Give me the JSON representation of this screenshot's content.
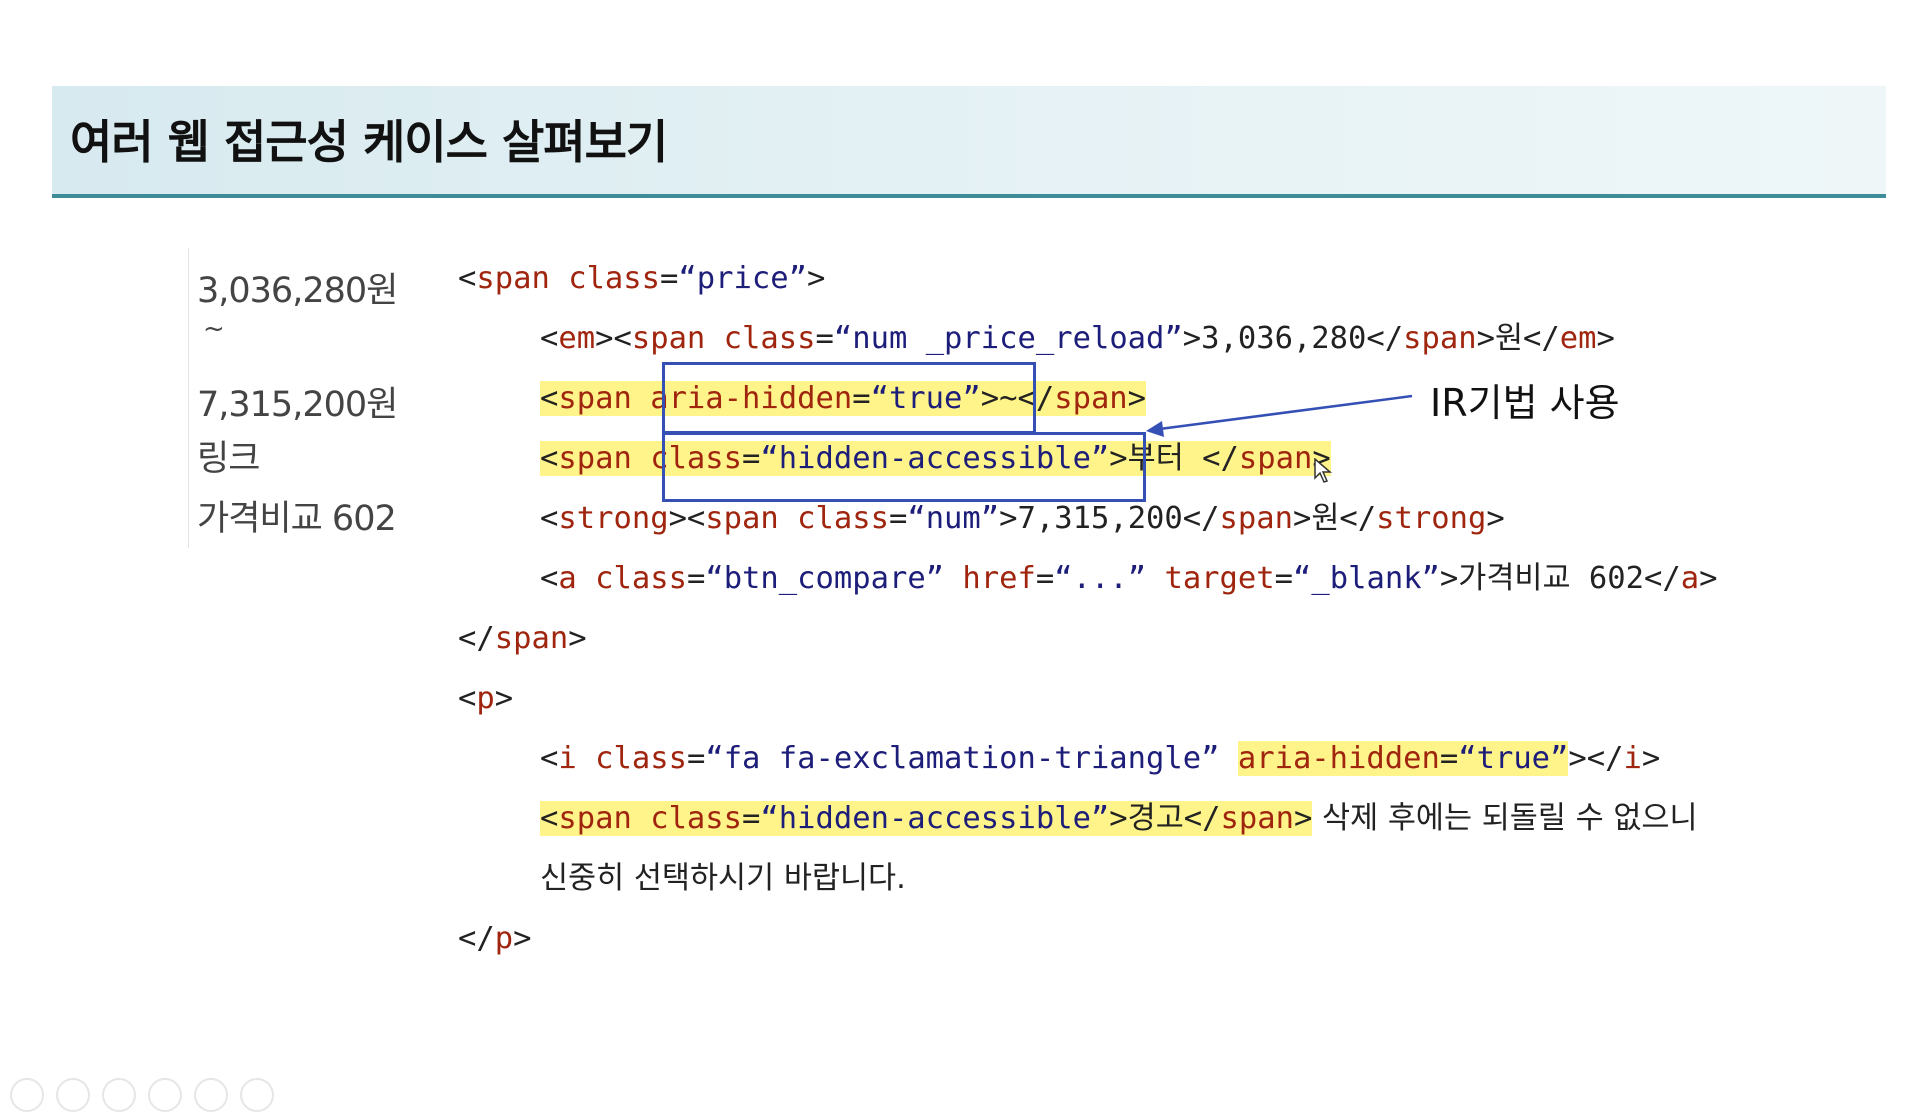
{
  "title": "여러 웹 접근성 케이스 살펴보기",
  "rendered_preview": {
    "lines": [
      "3,036,280원",
      "~",
      "7,315,200원",
      "링크",
      "가격비교 602"
    ]
  },
  "code": {
    "l1": {
      "open": "<",
      "tag": "span",
      "sp": " ",
      "attr": "class",
      "eq": "=",
      "val": "“price”",
      "close": ">"
    },
    "l2": {
      "a": "<",
      "b": "em",
      "c": "><",
      "d": "span",
      "e": " ",
      "f": "class",
      "g": "=",
      "h": "“num _price_reload”",
      "i": ">3,036,280</",
      "j": "span",
      "k": ">원</",
      "l": "em",
      "m": ">"
    },
    "l3": {
      "a": "<",
      "b": "span",
      "c": " ",
      "d": "aria-hidden",
      "e": "=",
      "f": "“true”",
      "g": ">~</",
      "h": "span",
      "i": ">"
    },
    "l4": {
      "a": "<",
      "b": "span",
      "c": " ",
      "d": "class",
      "e": "=",
      "f": "“hidden-accessible”",
      "g": ">부터 </",
      "h": "span",
      "i": ">"
    },
    "l5": {
      "a": "<",
      "b": "strong",
      "c": "><",
      "d": "span",
      "e": " ",
      "f": "class",
      "g": "=",
      "h": "“num”",
      "i": ">7,315,200</",
      "j": "span",
      "k": ">원</",
      "l": "strong",
      "m": ">"
    },
    "l6": {
      "a": "<",
      "b": "a",
      "c": " ",
      "d": "class",
      "e": "=",
      "f": "“btn_compare”",
      "g": " ",
      "h": "href",
      "i": "=",
      "j": "“...”",
      "k": " ",
      "l": "target",
      "m": "=",
      "n": "“_blank”",
      "o": ">가격비교 602</",
      "p": "a",
      "q": ">"
    },
    "l7": {
      "a": "</",
      "b": "span",
      "c": ">"
    },
    "l8": {
      "a": "<",
      "b": "p",
      "c": ">"
    },
    "l9": {
      "a": "<",
      "b": "i",
      "c": " ",
      "d": "class",
      "e": "=",
      "f": "“fa fa-exclamation-triangle”",
      "g": " ",
      "h": "aria-hidden",
      "i": "=",
      "j": "“true”",
      "k": "></",
      "l": "i",
      "m": ">"
    },
    "l10": {
      "a": "<",
      "b": "span",
      "c": " ",
      "d": "class",
      "e": "=",
      "f": "“hidden-accessible”",
      "g": ">경고</",
      "h": "span",
      "i": ">",
      "j": " 삭제 후에는 되돌릴 수 없으니"
    },
    "l11": {
      "a": "신중히 선택하시기 바랍니다."
    },
    "l12": {
      "a": "</",
      "b": "p",
      "c": ">"
    }
  },
  "annotation": "IR기법 사용",
  "colors": {
    "tag": "#a0250f",
    "value": "#1d1d7a",
    "highlight": "#fff48a",
    "box": "#3550b5",
    "title_border": "#3d8c97"
  }
}
